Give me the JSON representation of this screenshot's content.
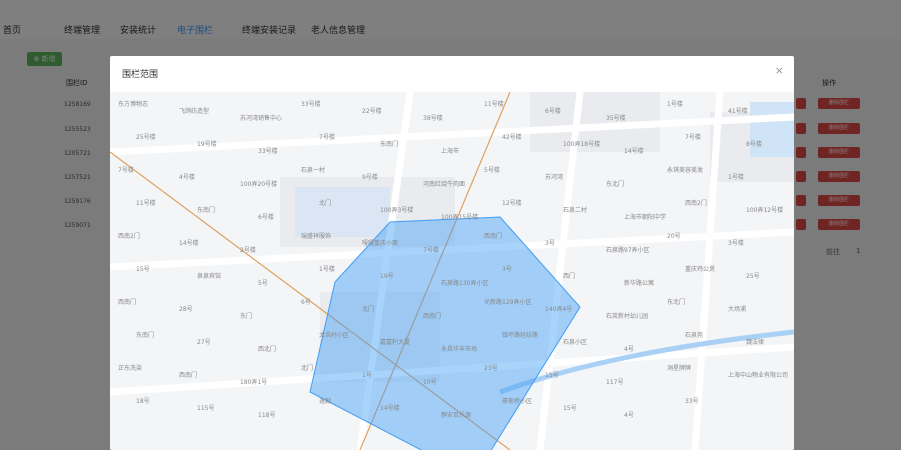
{
  "nav": {
    "items": [
      "首页",
      "终端管理",
      "安装统计",
      "电子围栏",
      "终端安装记录",
      "老人信息管理"
    ],
    "active_index": 3
  },
  "toolbar": {
    "add_label": "⊕ 新增"
  },
  "table": {
    "col_id": "围栏ID",
    "col_op": "操作",
    "rows": [
      "1258169",
      "1255523",
      "1205721",
      "1257521",
      "1259176",
      "1259071"
    ],
    "delete_label": "删除围栏"
  },
  "pager": {
    "next": "前往",
    "page": "1"
  },
  "dialog": {
    "title": "围栏范围",
    "close": "×"
  },
  "map": {
    "labels": [
      "东方博物志",
      "飞鸽纺造型",
      "苏河湾销售中心",
      "33号楼",
      "22号楼",
      "38号楼",
      "11号楼",
      "6号楼",
      "35号楼",
      "1号楼",
      "41号楼",
      "25号楼",
      "19号楼",
      "33号楼",
      "7号楼",
      "东南门",
      "上海市",
      "42号楼",
      "100弄18号楼",
      "14号楼",
      "7号楼",
      "8号楼",
      "7号楼",
      "4号楼",
      "100弄20号楼",
      "石泉一村",
      "9号楼",
      "河南红烧牛肉面",
      "5号楼",
      "苏河湾",
      "东北门",
      "永琪美容美发",
      "1号楼",
      "11号楼",
      "东南门",
      "6号楼",
      "北门",
      "100弄3号楼",
      "100弄15号楼",
      "12号楼",
      "石泉二村",
      "上海市朝阳中学",
      "西南2门",
      "100弄12号楼",
      "西南2门",
      "14号楼",
      "2号楼",
      "瑞盛祥服饰",
      "嘎嘎重庆小面",
      "7号楼",
      "西南门",
      "3号",
      "石泉路97弄小区",
      "20号",
      "3号楼",
      "15号",
      "泉泉宾馆",
      "5号",
      "1号楼",
      "19号",
      "石泉路130弄小区",
      "3号",
      "西门",
      "新华路公寓",
      "重庆鸡公煲",
      "25号",
      "西南门",
      "28号",
      "东门",
      "6号",
      "北门",
      "西南门",
      "光新路129弄小区",
      "140弄4号",
      "石岚新村幼儿园",
      "东北门",
      "大场浦",
      "东南门",
      "27号",
      "西北门",
      "太浩村小区",
      "嘉富利大厦",
      "永昌华丰市场",
      "镇坪路轻纺路",
      "石泉小区",
      "4号",
      "石泉苑",
      "魏法律",
      "正东洗染",
      "西南门",
      "180弄1号",
      "北门",
      "1号",
      "10号",
      "23号",
      "15号",
      "117号",
      "洞星牌牌",
      "上海中山物业有限公司",
      "18号",
      "115号",
      "118号",
      "逸剧",
      "14号楼",
      "静安百乐源",
      "豪家桥小区",
      "15号",
      "4号",
      "33号"
    ]
  },
  "colors": {
    "accent": "#409eff",
    "danger": "#e04b4b",
    "success": "#5cb85c",
    "fence": "#3d9ef5"
  }
}
